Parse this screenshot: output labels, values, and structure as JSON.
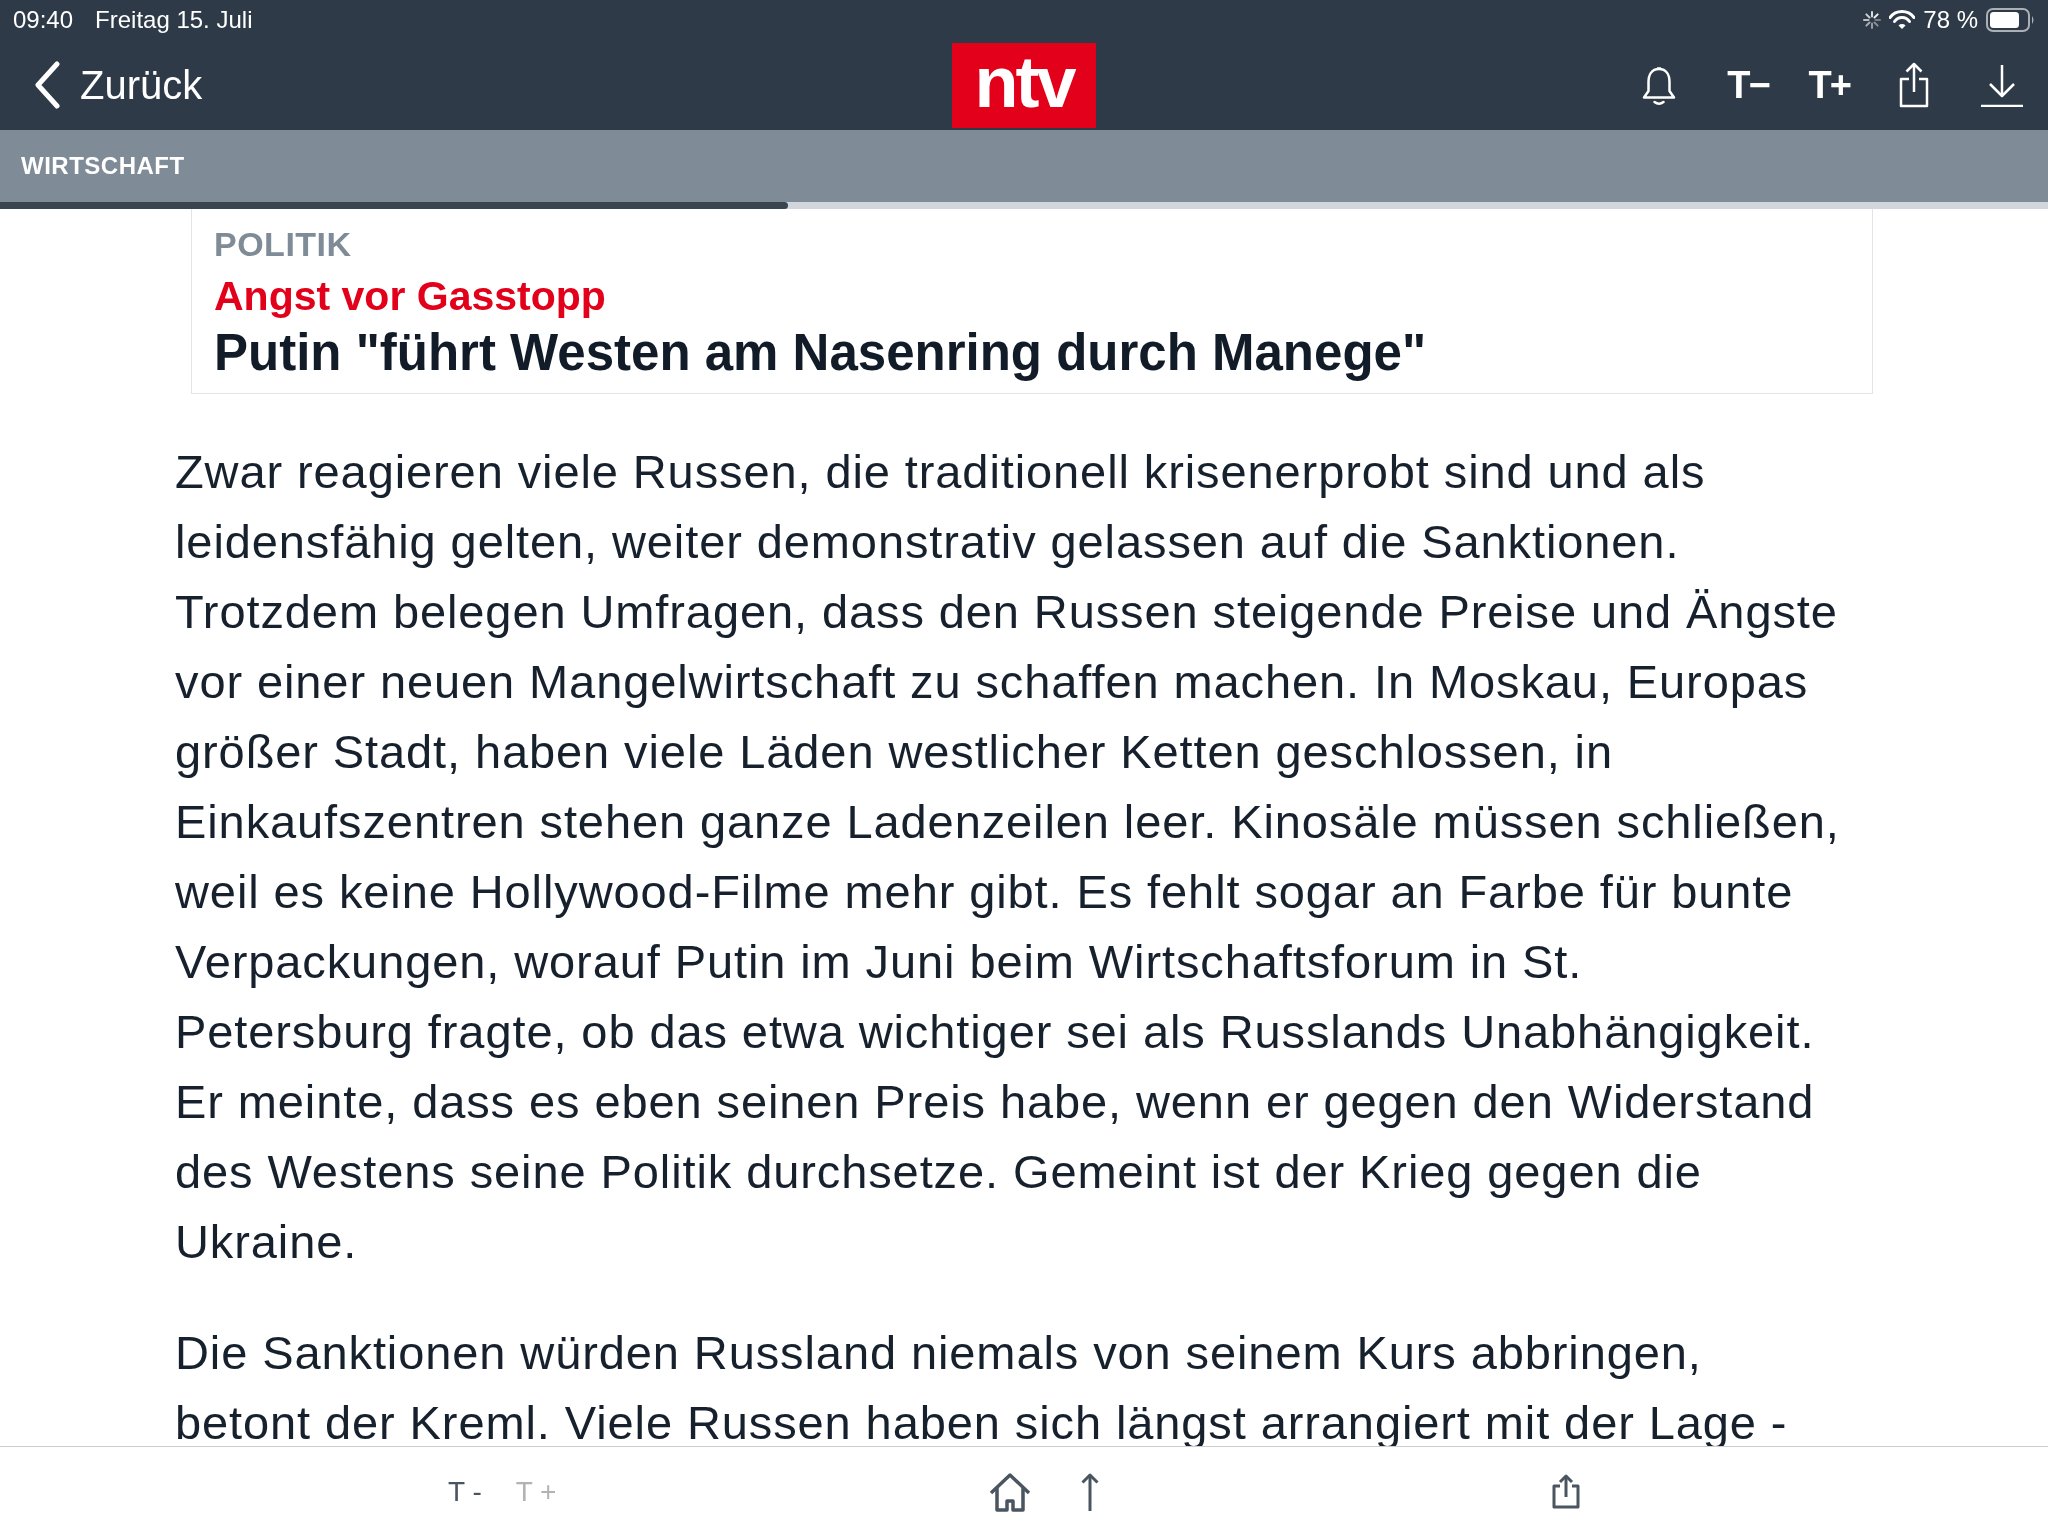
{
  "status_bar": {
    "time": "09:40",
    "date": "Freitag 15. Juli",
    "battery": "78 %"
  },
  "nav_bar": {
    "back_label": "Zurück",
    "logo": "ntv",
    "text_size_buttons": [
      {
        "label": "T−"
      },
      {
        "label": "T+"
      }
    ]
  },
  "section": {
    "label": "WIRTSCHAFT"
  },
  "reading_progress": {
    "level": 0.385
  },
  "article_header": {
    "category": "POLITIK",
    "kicker": "Angst vor Gasstopp",
    "title": "Putin \"führt Westen am Nasenring durch Manege\""
  },
  "body": [
    {
      "lines": [
        "Zwar reagieren viele Russen, die traditionell krisenerprobt sind und als",
        "leidensfähig gelten, weiter demonstrativ gelassen auf die Sanktionen.",
        "Trotzdem belegen Umfragen, dass den Russen steigende Preise und Ängste",
        "vor einer neuen Mangelwirtschaft zu schaffen machen. In Moskau, Europas",
        "größer Stadt, haben viele Läden westlicher Ketten geschlossen, in",
        "Einkaufszentren stehen ganze Ladenzeilen leer. Kinosäle müssen schließen,",
        "weil es keine Hollywood-Filme mehr gibt. Es fehlt sogar an Farbe für bunte",
        "Verpackungen, worauf Putin im Juni beim Wirtschaftsforum in St.",
        "Petersburg fragte, ob das etwa wichtiger sei als Russlands Unabhängigkeit.",
        "Er meinte, dass es eben seinen Preis habe, wenn er gegen den Widerstand",
        "des Westens seine Politik durchsetze. Gemeint ist der Krieg gegen die",
        "Ukraine."
      ]
    },
    {
      "lines": [
        "Die Sanktionen würden Russland niemals von seinem Kurs abbringen,",
        "betont der Kreml. Viele Russen haben sich längst arrangiert mit der Lage -"
      ]
    }
  ],
  "bottom_toolbar": {
    "text_smaller": {
      "label": "T -",
      "disabled": false
    },
    "text_larger": {
      "label": "T +",
      "disabled": true
    }
  }
}
